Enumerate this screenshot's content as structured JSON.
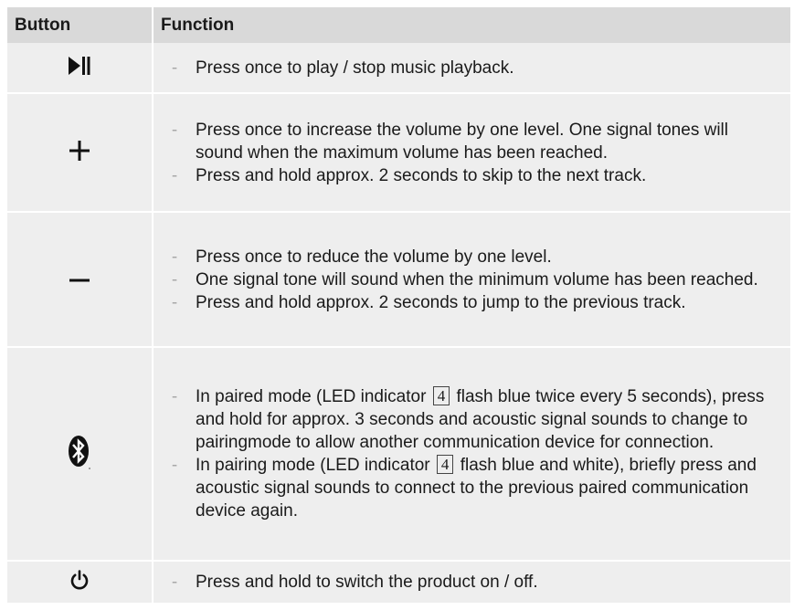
{
  "header": {
    "button_col": "Button",
    "function_col": "Function"
  },
  "rows": [
    {
      "icon": "play-pause-icon",
      "items": [
        {
          "text": "Press once to play / stop music playback."
        }
      ]
    },
    {
      "icon": "plus-icon",
      "items": [
        {
          "text": "Press once to increase the volume by one level. One signal tones will sound when the maximum volume has been reached."
        },
        {
          "text": "Press and hold approx. 2 seconds to skip to the next track."
        }
      ]
    },
    {
      "icon": "minus-icon",
      "items": [
        {
          "text": "Press once to reduce the volume by one level."
        },
        {
          "text": "One signal tone will sound when the minimum volume has been reached."
        },
        {
          "text": "Press and hold approx. 2 seconds to jump to the previous track."
        }
      ]
    },
    {
      "icon": "bluetooth-icon",
      "items": [
        {
          "pre": "In paired mode (LED indicator",
          "ref": "4",
          "post": "flash blue twice every 5 seconds), press and hold for approx. 3 seconds and acoustic signal sounds to change to pairingmode to allow another communication device for connection."
        },
        {
          "pre": "In pairing mode (LED indicator",
          "ref": "4",
          "post": "flash blue and white), briefly press and acoustic signal sounds to connect to the previous paired communication device again."
        }
      ]
    },
    {
      "icon": "power-icon",
      "items": [
        {
          "text": "Press and hold to switch the product on / off."
        }
      ]
    }
  ],
  "dash_char": "-",
  "colors": {
    "header_bg": "#d9d9d9",
    "row_bg": "#eeeeee",
    "dash": "#a8a8a8"
  }
}
